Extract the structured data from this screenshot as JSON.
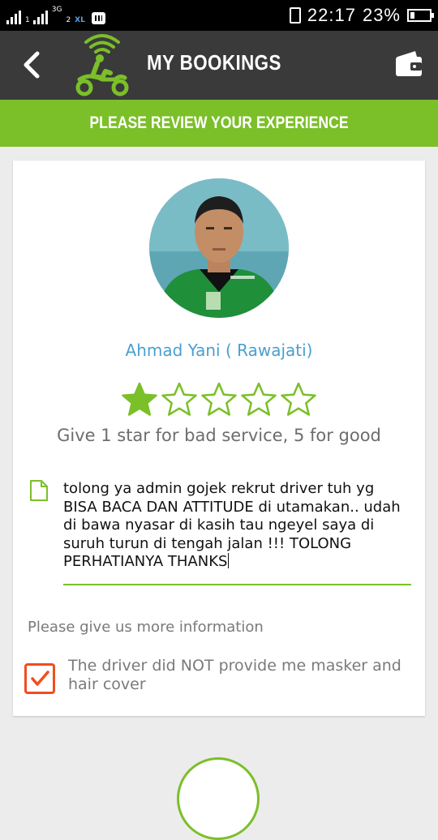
{
  "status_bar": {
    "carrier_1_icon": "signal-bars",
    "carrier_1_tag": "1",
    "carrier_2_tag": "3G",
    "carrier_3_tag": "2",
    "network_badge": "XL",
    "messenger_icon": "bbm-icon",
    "time": "22:17",
    "battery_percent": "23%"
  },
  "app_bar": {
    "title": "MY BOOKINGS",
    "back_icon": "back-arrow-icon",
    "logo_icon": "motorbike-rider-logo",
    "wallet_icon": "wallet-icon"
  },
  "banner": {
    "text": "PLEASE REVIEW YOUR EXPERIENCE"
  },
  "review": {
    "driver_name": "Ahmad Yani ( Rawajati)",
    "rating": 1,
    "max_rating": 5,
    "rating_hint": "Give 1 star for bad service, 5 for good",
    "comment": "tolong ya admin gojek rekrut driver tuh yg BISA BACA DAN ATTITUDE di utamakan.. udah di bawa nyasar di kasih tau ngeyel saya di suruh turun di tengah jalan !!! TOLONG PERHATIANYA THANKS",
    "more_info_label": "Please give us more information",
    "complaint_option": {
      "label": "The driver did NOT provide me masker and hair cover",
      "checked": true
    }
  },
  "colors": {
    "accent_green": "#7bbf29",
    "app_bar": "#3a3a3a",
    "name_blue": "#4a9fd0",
    "checkbox_orange": "#f04e1e"
  }
}
